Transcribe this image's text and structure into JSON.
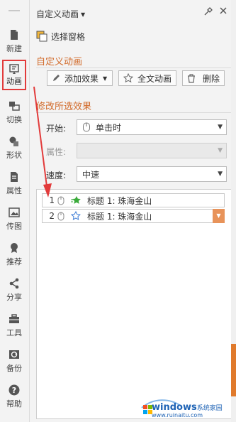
{
  "sidebar": {
    "items": [
      {
        "label": "新建",
        "icon": "new-file-icon"
      },
      {
        "label": "动画",
        "icon": "animation-icon",
        "active": true
      },
      {
        "label": "切换",
        "icon": "transition-icon"
      },
      {
        "label": "形状",
        "icon": "shape-icon"
      },
      {
        "label": "属性",
        "icon": "properties-icon"
      },
      {
        "label": "传图",
        "icon": "upload-image-icon"
      },
      {
        "label": "推荐",
        "icon": "recommend-icon"
      },
      {
        "label": "分享",
        "icon": "share-icon"
      },
      {
        "label": "工具",
        "icon": "toolbox-icon"
      },
      {
        "label": "备份",
        "icon": "backup-icon"
      },
      {
        "label": "帮助",
        "icon": "help-icon"
      }
    ]
  },
  "panel": {
    "title": "自定义动画",
    "select_pane_label": "选择窗格"
  },
  "custom_animation": {
    "section_title": "自定义动画",
    "add_effect_label": "添加效果",
    "full_text_label": "全文动画",
    "delete_label": "删除"
  },
  "modify": {
    "section_title": "修改所选效果",
    "start_label": "开始:",
    "start_value": "单击时",
    "property_label": "属性:",
    "property_value": "",
    "speed_label": "速度:",
    "speed_value": "中速"
  },
  "animation_list": [
    {
      "num": "1",
      "text": "标题 1: 珠海金山",
      "effect": "entrance-star-icon"
    },
    {
      "num": "2",
      "text": "标题 1: 珠海金山",
      "effect": "emphasis-star-icon",
      "selected": true
    }
  ],
  "watermark": {
    "brand": "windows",
    "site": "系统家园",
    "domain": "www.ruinaitu.com"
  },
  "colors": {
    "accent": "#d26b2b",
    "active_border": "#e23b3b",
    "dropdown": "#e8935a",
    "scroll_thumb": "#e07a2c"
  }
}
